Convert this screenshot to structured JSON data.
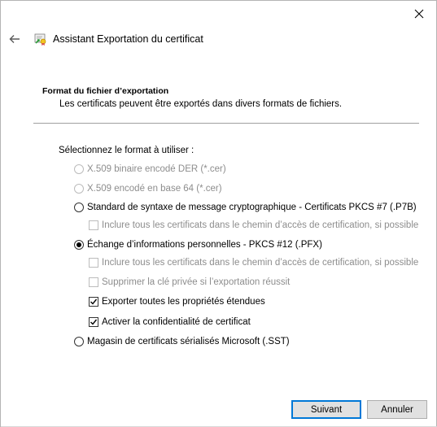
{
  "window": {
    "title": "Assistant Exportation du certificat"
  },
  "section": {
    "title": "Format du fichier d’exportation",
    "description": "Les certificats peuvent être exportés dans divers formats de fichiers."
  },
  "choose_label": "Sélectionnez le format à utiliser :",
  "options": {
    "der": {
      "label": "X.509 binaire encodé DER (*.cer)",
      "selected": false,
      "enabled": false
    },
    "base64": {
      "label": "X.509 encodé en base 64 (*.cer)",
      "selected": false,
      "enabled": false
    },
    "pkcs7": {
      "label": "Standard de syntaxe de message cryptographique - Certificats PKCS #7 (.P7B)",
      "selected": false,
      "enabled": true
    },
    "pkcs7_include": {
      "label": "Inclure tous les certificats dans le chemin d’accès de certification, si possible",
      "checked": false,
      "enabled": false
    },
    "pfx": {
      "label": "Échange d’informations personnelles - PKCS #12 (.PFX)",
      "selected": true,
      "enabled": true
    },
    "pfx_include": {
      "label": "Inclure tous les certificats dans le chemin d’accès de certification, si possible",
      "checked": false,
      "enabled": false
    },
    "pfx_delete_key": {
      "label": "Supprimer la clé privée si l’exportation réussit",
      "checked": false,
      "enabled": false
    },
    "pfx_export_props": {
      "label": "Exporter toutes les propriétés étendues",
      "checked": true,
      "enabled": true
    },
    "pfx_privacy": {
      "label": "Activer la confidentialité de certificat",
      "checked": true,
      "enabled": true
    },
    "sst": {
      "label": "Magasin de certificats sérialisés Microsoft (.SST)",
      "selected": false,
      "enabled": true
    }
  },
  "buttons": {
    "next": "Suivant",
    "cancel": "Annuler"
  },
  "colors": {
    "accent": "#0078d7",
    "disabled_text": "#8d8d8d"
  },
  "icons": {
    "back": "back-arrow-icon",
    "wizard": "certificate-wizard-icon",
    "close": "close-icon"
  }
}
